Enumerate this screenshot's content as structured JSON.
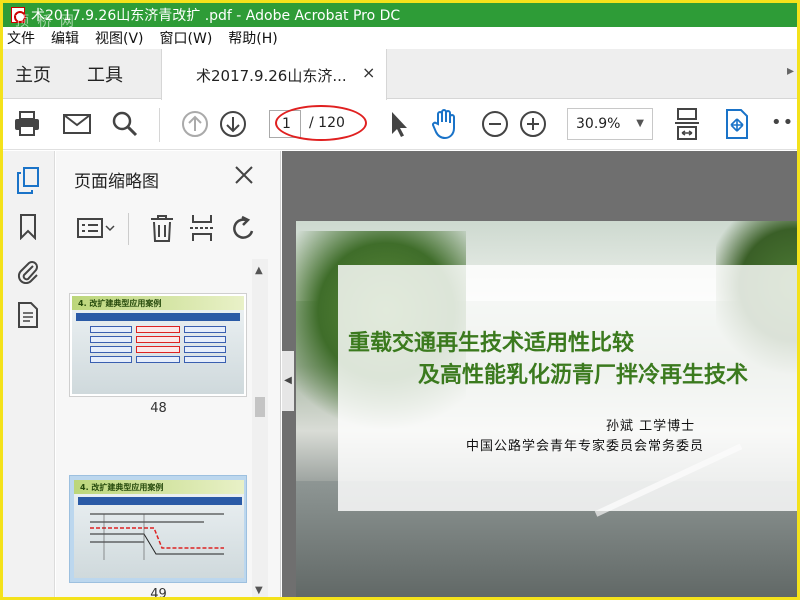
{
  "window": {
    "title": "术2017.9.26山东济青改扩 .pdf - Adobe Acrobat Pro DC",
    "watermark": "顶 桥 网"
  },
  "menu": {
    "items": [
      "文件",
      "编辑",
      "视图(V)",
      "窗口(W)",
      "帮助(H)"
    ]
  },
  "tabs": {
    "home": "主页",
    "tools": "工具",
    "document": "术2017.9.26山东济...",
    "close_glyph": "×"
  },
  "toolbar": {
    "page_current": "1",
    "page_total": "/ 120",
    "zoom": "30.9%",
    "more": "•••"
  },
  "thumbnails_panel": {
    "title": "页面缩略图",
    "pages": [
      {
        "number": "48",
        "header": "4. 改扩建典型应用案例",
        "selected": false
      },
      {
        "number": "49",
        "header": "4. 改扩建典型应用案例",
        "selected": true
      }
    ]
  },
  "slide": {
    "title_line1": "重载交通再生技术适用性比较",
    "title_line2": "及高性能乳化沥青厂拌冷再生技术",
    "author": "孙斌        工学博士",
    "affiliation": "中国公路学会青年专家委员会常务委员"
  },
  "colors": {
    "titlebar": "#2e9c37",
    "frame": "#f4e21b",
    "highlight_oval": "#e02020",
    "slide_title": "#3b7a1e",
    "icon_blue": "#1a73c8"
  }
}
